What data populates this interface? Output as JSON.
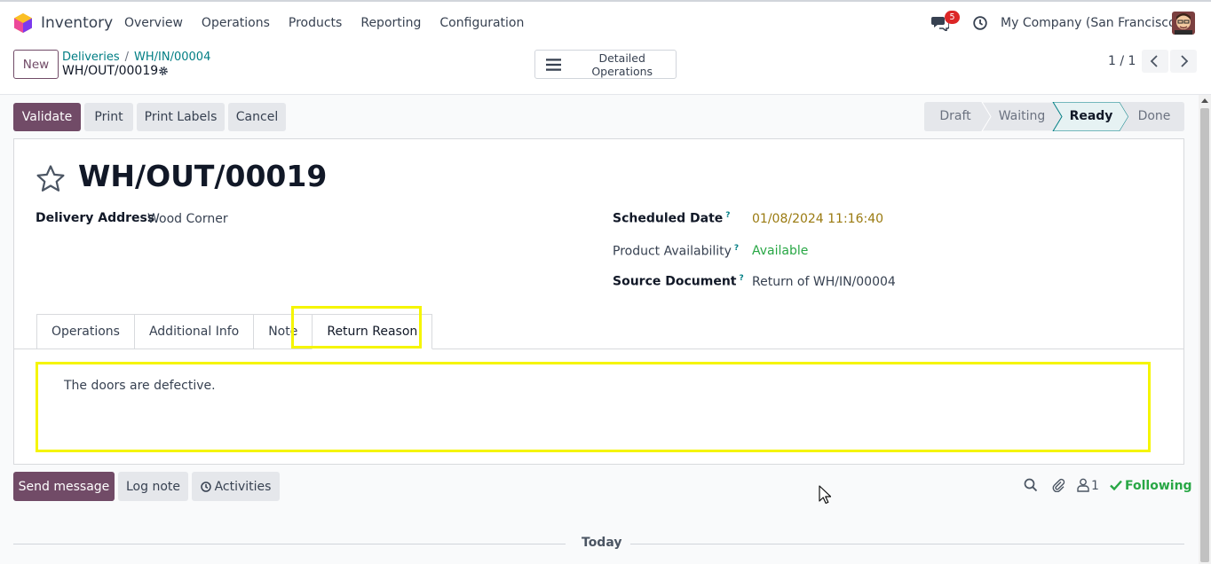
{
  "navbar": {
    "app_name": "Inventory",
    "menu": [
      "Overview",
      "Operations",
      "Products",
      "Reporting",
      "Configuration"
    ],
    "message_count": "5",
    "company": "My Company (San Francisco)"
  },
  "control": {
    "new_label": "New",
    "breadcrumbs": [
      "Deliveries",
      "WH/IN/00004"
    ],
    "record": "WH/OUT/00019",
    "detailed_ops_label": "Detailed Operations",
    "pager": "1 / 1"
  },
  "actions": {
    "validate": "Validate",
    "print": "Print",
    "print_labels": "Print Labels",
    "cancel": "Cancel"
  },
  "status": {
    "stages": [
      "Draft",
      "Waiting",
      "Ready",
      "Done"
    ],
    "current": "Ready",
    "active_color": "#e6f2f3"
  },
  "form": {
    "title": "WH/OUT/00019",
    "delivery_address_label": "Delivery Address",
    "delivery_address": "Wood Corner",
    "scheduled_date_label": "Scheduled Date",
    "scheduled_date": "01/08/2024 11:16:40",
    "availability_label": "Product Availability",
    "availability": "Available",
    "source_doc_label": "Source Document",
    "source_doc": "Return of WH/IN/00004",
    "help_marker": "?"
  },
  "tabs": [
    "Operations",
    "Additional Info",
    "Note",
    "Return Reason"
  ],
  "active_tab": "Return Reason",
  "return_reason_text": "The doors are defective.",
  "chatter": {
    "send_message": "Send message",
    "log_note": "Log note",
    "activities": "Activities",
    "followers": "1",
    "following": "Following",
    "today": "Today"
  },
  "colors": {
    "brand": "#714b67",
    "link": "#017e84",
    "highlight": "#f5f500",
    "success": "#28a745",
    "warning_date": "#9a7a10"
  }
}
